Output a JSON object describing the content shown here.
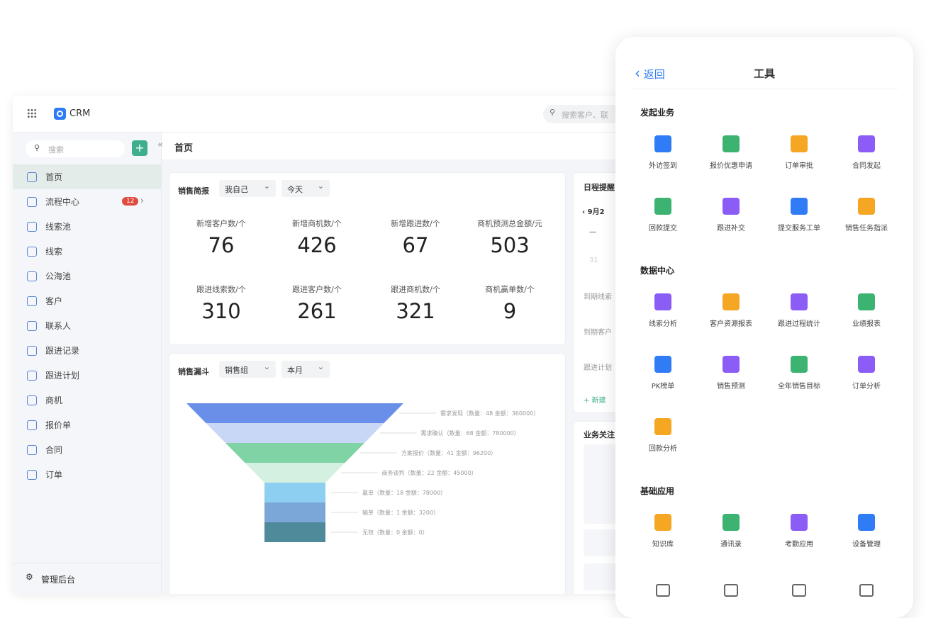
{
  "header": {
    "app": "CRM",
    "search_placeholder": "搜索客户、联"
  },
  "sidebar": {
    "search_placeholder": "搜索",
    "items": [
      {
        "label": "首页",
        "icon": "home-icon",
        "active": true
      },
      {
        "label": "流程中心",
        "icon": "workflow-icon",
        "badge": "12"
      },
      {
        "label": "线索池",
        "icon": "lead-pool-icon"
      },
      {
        "label": "线索",
        "icon": "lead-icon"
      },
      {
        "label": "公海池",
        "icon": "public-pool-icon"
      },
      {
        "label": "客户",
        "icon": "customer-icon"
      },
      {
        "label": "联系人",
        "icon": "contact-icon"
      },
      {
        "label": "跟进记录",
        "icon": "follow-record-icon"
      },
      {
        "label": "跟进计划",
        "icon": "follow-plan-icon"
      },
      {
        "label": "商机",
        "icon": "opportunity-icon"
      },
      {
        "label": "报价单",
        "icon": "quote-icon"
      },
      {
        "label": "合同",
        "icon": "contract-icon"
      },
      {
        "label": "订单",
        "icon": "order-icon"
      }
    ],
    "admin": "管理后台"
  },
  "breadcrumb": "首页",
  "brief": {
    "title": "销售简报",
    "filter1": "我自己",
    "filter2": "今天",
    "stats": [
      {
        "label": "新增客户数/个",
        "value": "76"
      },
      {
        "label": "新增商机数/个",
        "value": "426"
      },
      {
        "label": "新增跟进数/个",
        "value": "67"
      },
      {
        "label": "商机预测总金额/元",
        "value": "503"
      },
      {
        "label": "跟进线索数/个",
        "value": "310"
      },
      {
        "label": "跟进客户数/个",
        "value": "261"
      },
      {
        "label": "跟进商机数/个",
        "value": "321"
      },
      {
        "label": "商机赢单数/个",
        "value": "9"
      }
    ]
  },
  "funnel": {
    "title": "销售漏斗",
    "filter1": "销售组",
    "filter2": "本月"
  },
  "chart_data": {
    "type": "funnel",
    "stages": [
      {
        "name": "需求发现",
        "count": 48,
        "amount": 360000,
        "label": "需求发现（数量：48 金额：360000）",
        "color": "#6a8fe8"
      },
      {
        "name": "需求确认",
        "count": 68,
        "amount": 780000,
        "label": "需求确认（数量：68 金额：780000）",
        "color": "#c9d7f7"
      },
      {
        "name": "方案报价",
        "count": 41,
        "amount": 96200,
        "label": "方案报价（数量：41 金额：96200）",
        "color": "#7fd3a4"
      },
      {
        "name": "商务谈判",
        "count": 22,
        "amount": 45000,
        "label": "商务谈判（数量：22 金额：45000）",
        "color": "#d3f0e1"
      },
      {
        "name": "赢单",
        "count": 18,
        "amount": 78000,
        "label": "赢单（数量：18 金额：78000）",
        "color": "#8dcff0"
      },
      {
        "name": "输单",
        "count": 1,
        "amount": 3200,
        "label": "输单（数量：1 金额：3200）",
        "color": "#7aa7d8"
      },
      {
        "name": "无效",
        "count": 0,
        "amount": 0,
        "label": "无效（数量：0 金额：0）",
        "color": "#4e8a9a"
      }
    ]
  },
  "schedule": {
    "title": "日程提醒",
    "date": "9月2",
    "dash": "—",
    "day": "31",
    "rows": [
      "到期线索",
      "到期客户",
      "跟进计划"
    ],
    "new": "+ 新建"
  },
  "focus": {
    "title": "业务关注"
  },
  "phone": {
    "back": "返回",
    "title": "工具",
    "sections": [
      {
        "title": "发起业务",
        "tools": [
          {
            "label": "外访签到",
            "icon": "checkin-icon",
            "color": "#2f7cf6"
          },
          {
            "label": "报价优惠申请",
            "icon": "discount-icon",
            "color": "#3cb371"
          },
          {
            "label": "订单审批",
            "icon": "stamp-icon",
            "color": "#f5a623"
          },
          {
            "label": "合同发起",
            "icon": "tag-icon",
            "color": "#8b5cf6"
          },
          {
            "label": "回款提交",
            "icon": "wallet-icon",
            "color": "#3cb371"
          },
          {
            "label": "跟进补交",
            "icon": "doc-edit-icon",
            "color": "#8b5cf6"
          },
          {
            "label": "提交服务工单",
            "icon": "service-icon",
            "color": "#2f7cf6"
          },
          {
            "label": "销售任务指派",
            "icon": "card-icon",
            "color": "#f5a623"
          }
        ]
      },
      {
        "title": "数据中心",
        "tools": [
          {
            "label": "线索分析",
            "icon": "lead-analysis-icon",
            "color": "#8b5cf6"
          },
          {
            "label": "客户资源报表",
            "icon": "customer-report-icon",
            "color": "#f5a623"
          },
          {
            "label": "跟进过程统计",
            "icon": "monitor-icon",
            "color": "#8b5cf6"
          },
          {
            "label": "业绩报表",
            "icon": "calculator-icon",
            "color": "#3cb371"
          },
          {
            "label": "PK榜单",
            "icon": "bar-chart-icon",
            "color": "#2f7cf6"
          },
          {
            "label": "销售预测",
            "icon": "pie-chart-icon",
            "color": "#8b5cf6"
          },
          {
            "label": "全年销售目标",
            "icon": "target-icon",
            "color": "#3cb371"
          },
          {
            "label": "订单分析",
            "icon": "cart-icon",
            "color": "#8b5cf6"
          },
          {
            "label": "回款分析",
            "icon": "alarm-icon",
            "color": "#f5a623"
          }
        ]
      },
      {
        "title": "基础应用",
        "tools": [
          {
            "label": "知识库",
            "icon": "book-icon",
            "color": "#f5a623"
          },
          {
            "label": "通讯录",
            "icon": "address-book-icon",
            "color": "#3cb371"
          },
          {
            "label": "考勤应用",
            "icon": "calendar-icon",
            "color": "#8b5cf6"
          },
          {
            "label": "设备管理",
            "icon": "device-icon",
            "color": "#2f7cf6"
          }
        ]
      }
    ],
    "tabs": [
      "apps-icon",
      "document-icon",
      "cube-icon",
      "user-icon"
    ]
  }
}
